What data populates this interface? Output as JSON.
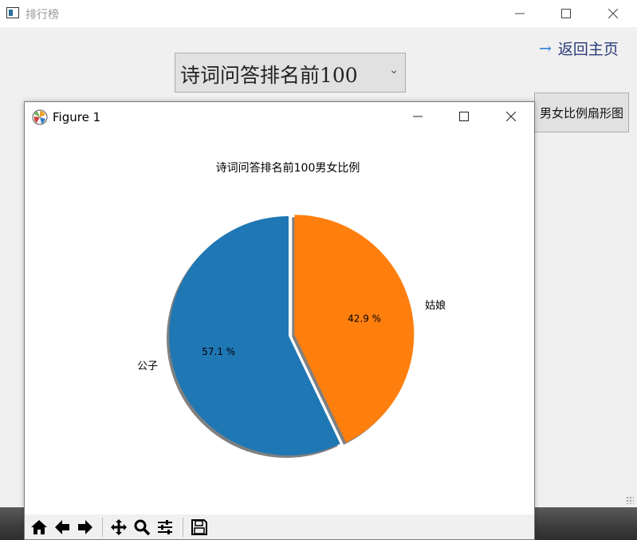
{
  "app": {
    "title": "排行榜",
    "back_label": "返回主页",
    "combo_value": "诗词问答排名前100",
    "pie_button_label": "男女比例扇形图"
  },
  "figure": {
    "title": "Figure 1"
  },
  "chart_data": {
    "type": "pie",
    "title": "诗词问答排名前100男女比例",
    "categories": [
      "公子",
      "姑娘"
    ],
    "values": [
      57.1,
      42.9
    ],
    "percent_labels": [
      "57.1 %",
      "42.9 %"
    ],
    "colors": [
      "#1f77b4",
      "#ff7f0e"
    ],
    "explode": [
      0,
      0.05
    ],
    "shadow": true,
    "start_angle_deg": 90
  },
  "toolbar": {
    "icons": [
      "home-icon",
      "back-icon",
      "forward-icon",
      "pan-icon",
      "zoom-icon",
      "configure-icon",
      "save-icon"
    ]
  }
}
